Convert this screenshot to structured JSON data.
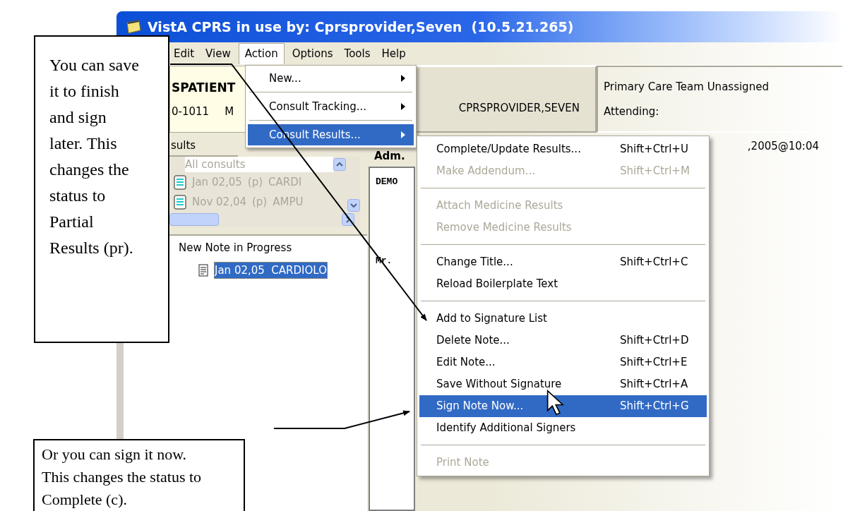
{
  "window": {
    "title": "VistA CPRS in use by: Cprsprovider,Seven  (10.5.21.265)"
  },
  "menu_bar": [
    {
      "label": "Edit",
      "selected": false
    },
    {
      "label": "View",
      "selected": false
    },
    {
      "label": "Action",
      "selected": true
    },
    {
      "label": "Options",
      "selected": false
    },
    {
      "label": "Tools",
      "selected": false
    },
    {
      "label": "Help",
      "selected": false
    }
  ],
  "patient": {
    "name": "SPATIENT",
    "id": "0-1011",
    "sex": "M"
  },
  "provider": "CPRSPROVIDER,SEVEN",
  "primary_care": {
    "team": "Primary Care Team Unassigned",
    "attending": "Attending:"
  },
  "left_pane": {
    "tab": "sults",
    "filter": "All consults",
    "consults": [
      {
        "date": "Jan 02,05",
        "status": "(p)",
        "title": "CARDI"
      },
      {
        "date": "Nov 02,04",
        "status": "(p)",
        "title": "AMPU"
      }
    ],
    "tree": {
      "label": "New Note in Progress",
      "children": [
        {
          "label": "Jan 02,05  CARDIOLO",
          "selected": true
        }
      ]
    }
  },
  "right_pane": {
    "header_left": "Adm.",
    "header_date": ",2005@10:04",
    "document_lines": [
      "DEMO",
      "Mr."
    ]
  },
  "action_menu": [
    {
      "kind": "item",
      "label": "New...",
      "selected": false
    },
    {
      "kind": "separator"
    },
    {
      "kind": "item",
      "label": "Consult Tracking...",
      "selected": false
    },
    {
      "kind": "separator"
    },
    {
      "kind": "item",
      "label": "Consult Results...",
      "selected": true
    }
  ],
  "submenu": [
    {
      "kind": "item",
      "label": "Complete/Update Results...",
      "shortcut": "Shift+Ctrl+U",
      "disabled": false,
      "selected": false
    },
    {
      "kind": "item",
      "label": "Make Addendum...",
      "shortcut": "Shift+Ctrl+M",
      "disabled": true,
      "selected": false
    },
    {
      "kind": "separator"
    },
    {
      "kind": "item",
      "label": "Attach Medicine Results",
      "disabled": true,
      "selected": false
    },
    {
      "kind": "item",
      "label": "Remove Medicine Results",
      "disabled": true,
      "selected": false
    },
    {
      "kind": "separator"
    },
    {
      "kind": "item",
      "label": "Change Title...",
      "shortcut": "Shift+Ctrl+C",
      "disabled": false,
      "selected": false
    },
    {
      "kind": "item",
      "label": "Reload Boilerplate Text",
      "disabled": false,
      "selected": false
    },
    {
      "kind": "separator"
    },
    {
      "kind": "item",
      "label": "Add to Signature List",
      "disabled": false,
      "selected": false
    },
    {
      "kind": "item",
      "label": "Delete Note...",
      "shortcut": "Shift+Ctrl+D",
      "disabled": false,
      "selected": false
    },
    {
      "kind": "item",
      "label": "Edit Note...",
      "shortcut": "Shift+Ctrl+E",
      "disabled": false,
      "selected": false
    },
    {
      "kind": "item",
      "label": "Save Without Signature",
      "shortcut": "Shift+Ctrl+A",
      "disabled": false,
      "selected": false
    },
    {
      "kind": "item",
      "label": "Sign Note Now...",
      "shortcut": "Shift+Ctrl+G",
      "disabled": false,
      "selected": true
    },
    {
      "kind": "item",
      "label": "Identify Additional Signers",
      "disabled": false,
      "selected": false
    },
    {
      "kind": "separator"
    },
    {
      "kind": "item",
      "label": "Print Note",
      "disabled": true,
      "selected": false
    }
  ],
  "callouts": [
    {
      "text": "You can save it to finish and sign later. This changes the status to Partial Results (pr)."
    },
    {
      "text": "Or you can sign it now. This changes the status to Complete (c)."
    }
  ]
}
